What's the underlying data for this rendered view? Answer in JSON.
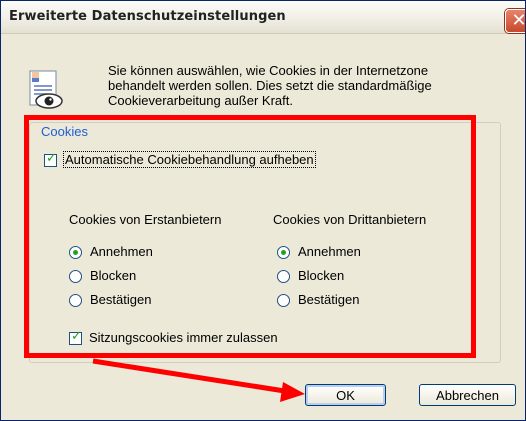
{
  "window": {
    "title": "Erweiterte Datenschutzeinstellungen",
    "close_glyph": "✕"
  },
  "intro_text": "Sie können auswählen, wie Cookies in der Internetzone behandelt werden sollen. Dies setzt die standardmäßige Cookieverarbeitung außer Kraft.",
  "cookies_group": {
    "title": "Cookies",
    "override_label": "Automatische Cookiebehandlung aufheben",
    "override_checked": true,
    "first_party": {
      "heading": "Cookies von Erstanbietern",
      "options": [
        "Annehmen",
        "Blocken",
        "Bestätigen"
      ],
      "selected": "Annehmen"
    },
    "third_party": {
      "heading": "Cookies von Drittanbietern",
      "options": [
        "Annehmen",
        "Blocken",
        "Bestätigen"
      ],
      "selected": "Annehmen"
    },
    "session_label": "Sitzungscookies immer zulassen",
    "session_checked": true
  },
  "buttons": {
    "ok": "OK",
    "cancel": "Abbrechen"
  },
  "annotation_color": "#ff0000",
  "accent_color": "#1c5fd6",
  "check_color": "#21a121"
}
